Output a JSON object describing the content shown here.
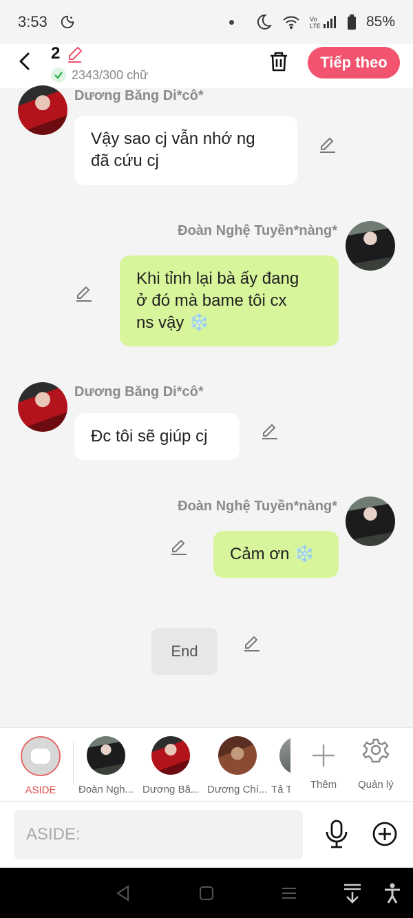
{
  "status": {
    "time": "3:53",
    "battery": "85%",
    "colors": {
      "icons": "#333333"
    }
  },
  "header": {
    "count": "2",
    "word_count": "2343/300 chữ",
    "next_label": "Tiếp theo",
    "accent": "#f2536e"
  },
  "messages": [
    {
      "side": "left",
      "sender": "Dương Băng Di*cô*",
      "text_lines": [
        "Vậy sao cj vẫn nhớ ng",
        "đã cứu cj"
      ]
    },
    {
      "side": "right",
      "sender": "Đoàn Nghệ Tuyền*nàng*",
      "text_lines": [
        "Khi tỉnh lại bà ấy đang",
        "ở đó mà bame tôi cx",
        "ns vậy ❄️"
      ]
    },
    {
      "side": "left",
      "sender": "Dương Băng Di*cô*",
      "text_lines": [
        "Đc tôi sẽ giúp cj"
      ]
    },
    {
      "side": "right",
      "sender": "Đoàn Nghệ Tuyền*nàng*",
      "text_lines": [
        "Cảm ơn ❄️"
      ]
    }
  ],
  "end_label": "End",
  "characters": [
    {
      "label": "ASIDE",
      "icon": "aside-icon"
    },
    {
      "label": "Đoàn Ngh..."
    },
    {
      "label": "Dương Bă..."
    },
    {
      "label": "Dương Chí..."
    },
    {
      "label": "Tả T"
    },
    {
      "label": "Thêm",
      "icon": "plus-icon"
    },
    {
      "label": "Quản lý",
      "icon": "gear-icon"
    }
  ],
  "input": {
    "placeholder": "ASIDE:"
  },
  "bubble_colors": {
    "left": "#ffffff",
    "right": "#d7f59b"
  }
}
